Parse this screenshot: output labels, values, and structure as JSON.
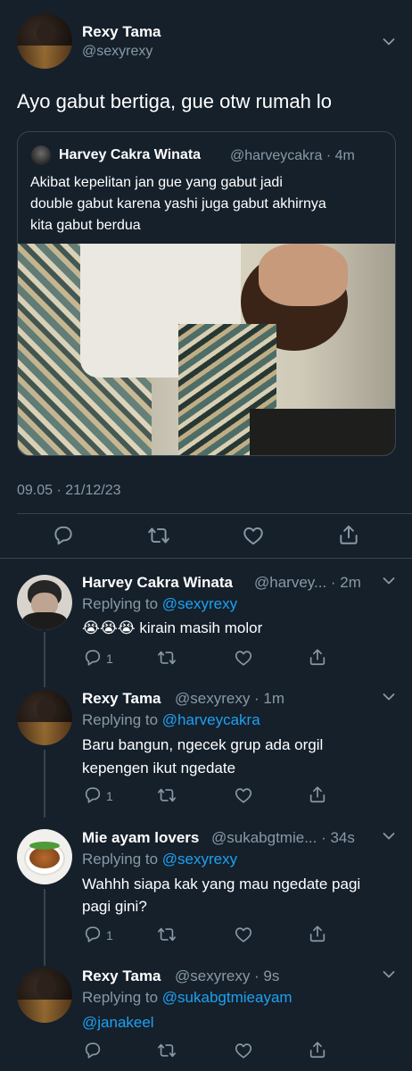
{
  "main_tweet": {
    "author_name": "Rexy Tama",
    "author_handle": "@sexyrexy",
    "text": "Ayo gabut bertiga, gue otw rumah lo",
    "timestamp": "09.05 · 21/12/23",
    "quoted": {
      "author_name": "Harvey Cakra Winata",
      "meta": "@harveycakra · 4m",
      "text_lines": [
        "Akibat kepelitan jan gue yang gabut jadi",
        "double gabut karena yashi juga gabut akhirnya",
        "kita gabut berdua"
      ]
    }
  },
  "replies": [
    {
      "author_name": "Harvey Cakra Winata",
      "handle_time": "@harvey... · 2m",
      "replying_prefix": "Replying to",
      "replying_to": "@sexyrexy",
      "text_lines": [
        "😭😭😭 kirain masih molor"
      ],
      "reply_count": "1"
    },
    {
      "author_name": "Rexy Tama",
      "handle_time": "@sexyrexy · 1m",
      "replying_prefix": "Replying to",
      "replying_to": "@harveycakra",
      "text_lines": [
        "Baru bangun, ngecek grup ada orgil",
        "kepengen ikut ngedate"
      ],
      "reply_count": "1"
    },
    {
      "author_name": "Mie ayam lovers",
      "handle_time": "@sukabgtmie... · 34s",
      "replying_prefix": "Replying to",
      "replying_to": "@sexyrexy",
      "text_lines": [
        "Wahhh siapa kak yang mau ngedate pagi",
        "pagi gini?"
      ],
      "reply_count": "1"
    },
    {
      "author_name": "Rexy Tama",
      "handle_time": "@sexyrexy · 9s",
      "replying_prefix": "Replying to",
      "replying_to": "@sukabgtmieayam",
      "text_lines": [
        "@janakeel"
      ],
      "reply_count": ""
    }
  ],
  "icons": {
    "reply": "reply-icon",
    "retweet": "retweet-icon",
    "like": "like-icon",
    "share": "share-icon",
    "more": "chevron-down-icon"
  },
  "colors": {
    "background": "#15202b",
    "muted": "#8899a6",
    "link": "#1da1f2",
    "divider": "#38444d"
  }
}
